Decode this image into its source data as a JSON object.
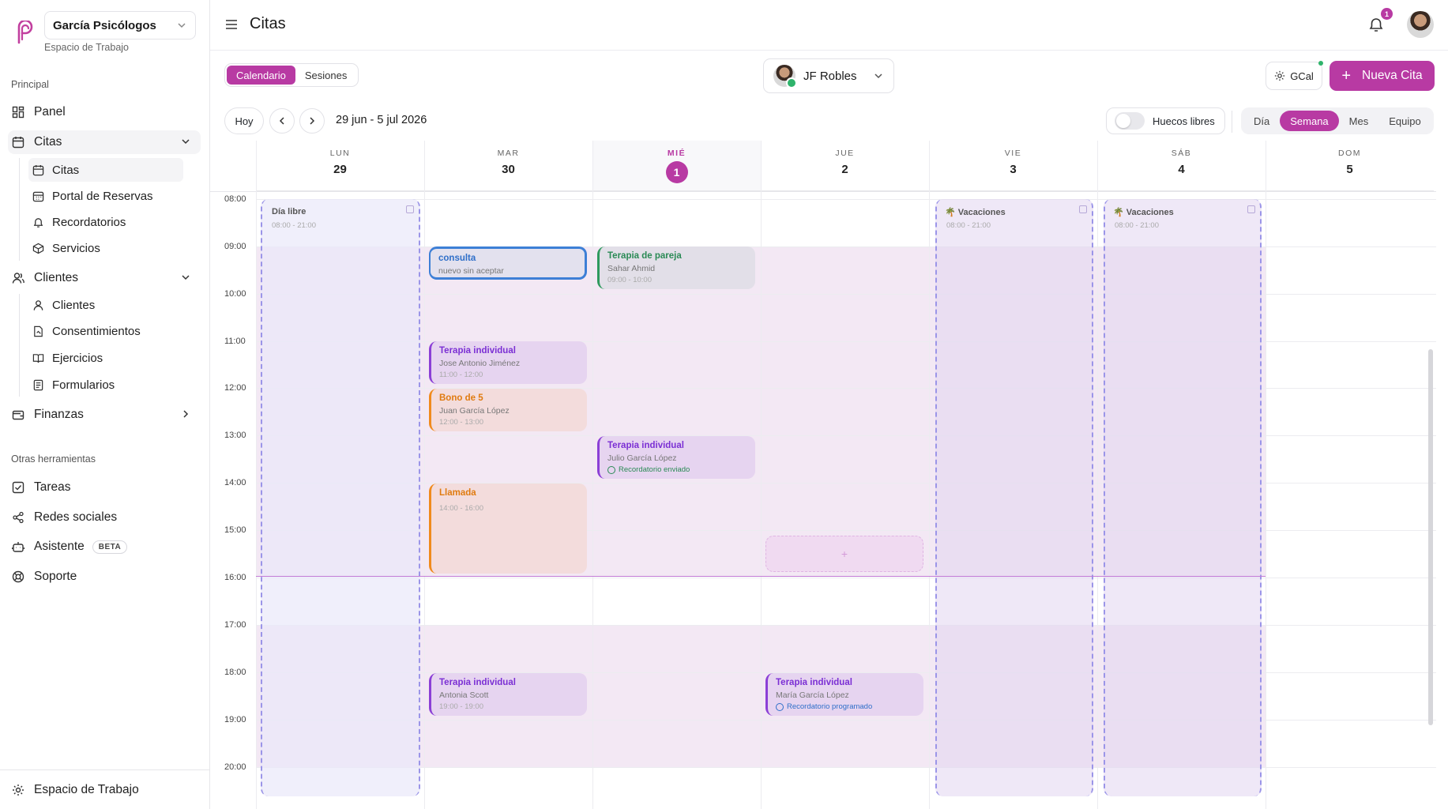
{
  "sidebar": {
    "workspace_name": "García Psicólogos",
    "workspace_sub": "Espacio de Trabajo",
    "section_principal": "Principal",
    "panel": "Panel",
    "citas": "Citas",
    "citas_sub": [
      "Citas",
      "Portal de Reservas",
      "Recordatorios",
      "Servicios"
    ],
    "clientes": "Clientes",
    "clientes_sub": [
      "Clientes",
      "Consentimientos",
      "Ejercicios",
      "Formularios"
    ],
    "finanzas": "Finanzas",
    "section_otras": "Otras herramientas",
    "tareas": "Tareas",
    "redes": "Redes sociales",
    "asistente": "Asistente",
    "beta": "BETA",
    "soporte": "Soporte",
    "bottom": "Espacio de Trabajo"
  },
  "header": {
    "title": "Citas",
    "notifications": "1"
  },
  "toolbar": {
    "tab_calendar": "Calendario",
    "tab_sessions": "Sesiones",
    "user": "JF Robles",
    "gcal": "GCal",
    "new_button": "Nueva Cita",
    "today": "Hoy",
    "range": "29 jun - 5 jul 2026",
    "free_slots": "Huecos libres",
    "views": [
      "Día",
      "Semana",
      "Mes",
      "Equipo"
    ],
    "active_view": "Semana"
  },
  "calendar": {
    "days": [
      {
        "dow": "LUN",
        "num": "29"
      },
      {
        "dow": "MAR",
        "num": "30"
      },
      {
        "dow": "MIÉ",
        "num": "1"
      },
      {
        "dow": "JUE",
        "num": "2"
      },
      {
        "dow": "VIE",
        "num": "3"
      },
      {
        "dow": "SÁB",
        "num": "4"
      },
      {
        "dow": "DOM",
        "num": "5"
      }
    ],
    "today_index": 2,
    "hours": [
      "08:00",
      "09:00",
      "10:00",
      "11:00",
      "12:00",
      "13:00",
      "14:00",
      "15:00",
      "16:00",
      "17:00",
      "18:00",
      "19:00",
      "20:00"
    ],
    "allday": [
      {
        "title": "Día libre",
        "time": "08:00 - 21:00"
      },
      {
        "title": "Vacaciones",
        "time": "08:00 - 21:00"
      },
      {
        "title": "Vacaciones",
        "time": "08:00 - 21:00"
      }
    ],
    "events": [
      {
        "title": "consulta",
        "sub": "nuevo sin aceptar",
        "color": "blue"
      },
      {
        "title": "Terapia de pareja",
        "sub": "Sahar Ahmid",
        "time": "09:00 - 10:00",
        "color": "green"
      },
      {
        "title": "Terapia individual",
        "sub": "Jose Antonio Jiménez",
        "time": "11:00 - 12:00",
        "color": "purple"
      },
      {
        "title": "Bono de 5",
        "sub": "Juan García López",
        "time": "12:00 - 13:00",
        "color": "orange"
      },
      {
        "title": "Terapia individual",
        "sub": "Julio García López",
        "reminder": "Recordatorio enviado",
        "color": "purple"
      },
      {
        "title": "Llamada",
        "time": "14:00 - 16:00",
        "color": "orange"
      },
      {
        "title": "Terapia individual",
        "sub": "Antonia Scott",
        "time": "19:00 - 19:00",
        "color": "purple"
      },
      {
        "title": "Terapia individual",
        "sub": "María García López",
        "reminder": "Recordatorio programado",
        "color": "purple"
      }
    ],
    "drop_slot": "+"
  },
  "colors": {
    "accent": "#b83aa3",
    "event_purple": "#8b3fd6",
    "event_blue": "#3d7fd6",
    "event_green": "#2f9a5e",
    "event_orange": "#f08a1c",
    "allday_border": "#9b95e8"
  },
  "icons": {
    "logo": "brand-p-logo",
    "menu": "hamburger-icon",
    "bell": "bell-icon",
    "gear": "gear-icon",
    "chevron_down": "chevron-down-icon",
    "chevron_right": "chevron-right-icon",
    "palm": "palm-tree-icon"
  }
}
